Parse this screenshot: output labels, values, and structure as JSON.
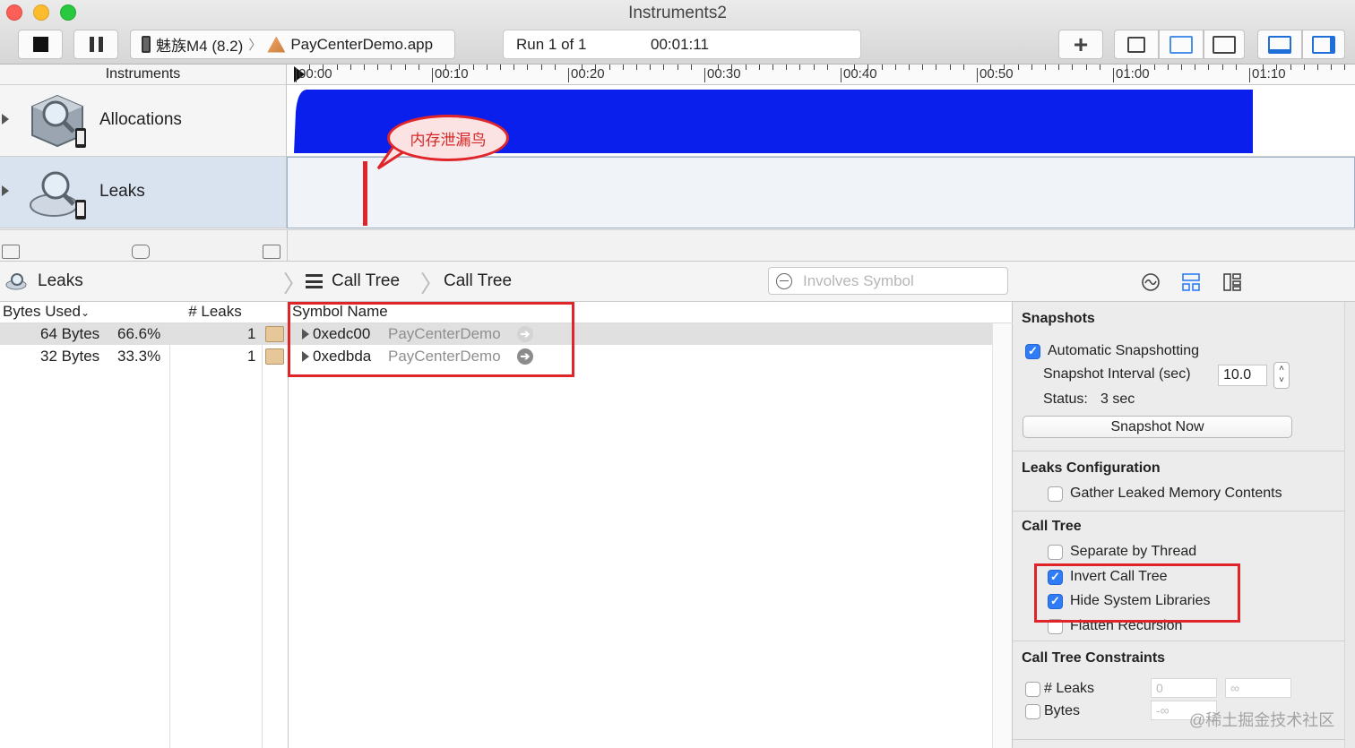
{
  "window": {
    "title": "Instruments2"
  },
  "toolbar": {
    "device": "魅族M4 (8.2)",
    "app": "PayCenterDemo.app",
    "run": "Run 1 of 1",
    "elapsed": "00:01:11"
  },
  "timeline": {
    "instruments_label": "Instruments",
    "ticks": [
      "00:00",
      "00:10",
      "00:20",
      "00:30",
      "00:40",
      "00:50",
      "01:00",
      "01:10"
    ],
    "tracks": [
      {
        "name": "Allocations",
        "icon": "allocations-instrument-icon"
      },
      {
        "name": "Leaks",
        "icon": "leaks-instrument-icon"
      }
    ],
    "annotation": "内存泄漏鸟",
    "accent": "#0a1eec",
    "leak_marker_color": "#e0252a"
  },
  "detail": {
    "instrument": "Leaks",
    "breadcrumb": [
      "Call Tree",
      "Call Tree"
    ],
    "search_placeholder": "Involves Symbol",
    "columns": {
      "bytes": "Bytes Used",
      "leaks": "# Leaks",
      "symbol": "Symbol Name"
    },
    "rows": [
      {
        "bytes": "64 Bytes",
        "percent": "66.6%",
        "leaks": "1",
        "address": "0xedc00",
        "library": "PayCenterDemo"
      },
      {
        "bytes": "32 Bytes",
        "percent": "33.3%",
        "leaks": "1",
        "address": "0xedbda",
        "library": "PayCenterDemo"
      }
    ]
  },
  "inspector": {
    "snapshots": {
      "title": "Snapshots",
      "auto": "Automatic Snapshotting",
      "auto_checked": true,
      "interval_label": "Snapshot Interval (sec)",
      "interval_value": "10.0",
      "status_label": "Status:",
      "status_value": "3 sec",
      "button": "Snapshot Now"
    },
    "leaks_config": {
      "title": "Leaks Configuration",
      "gather": "Gather Leaked Memory Contents",
      "gather_checked": false
    },
    "call_tree": {
      "title": "Call Tree",
      "options": [
        {
          "label": "Separate by Thread",
          "checked": false
        },
        {
          "label": "Invert Call Tree",
          "checked": true
        },
        {
          "label": "Hide System Libraries",
          "checked": true
        },
        {
          "label": "Flatten Recursion",
          "checked": false
        }
      ]
    },
    "constraints": {
      "title": "Call Tree Constraints",
      "leaks": "# Leaks",
      "bytes": "Bytes",
      "leaks_min": "0",
      "leaks_max": "∞",
      "bytes_min": "-∞"
    }
  },
  "watermark": "@稀土掘金技术社区"
}
